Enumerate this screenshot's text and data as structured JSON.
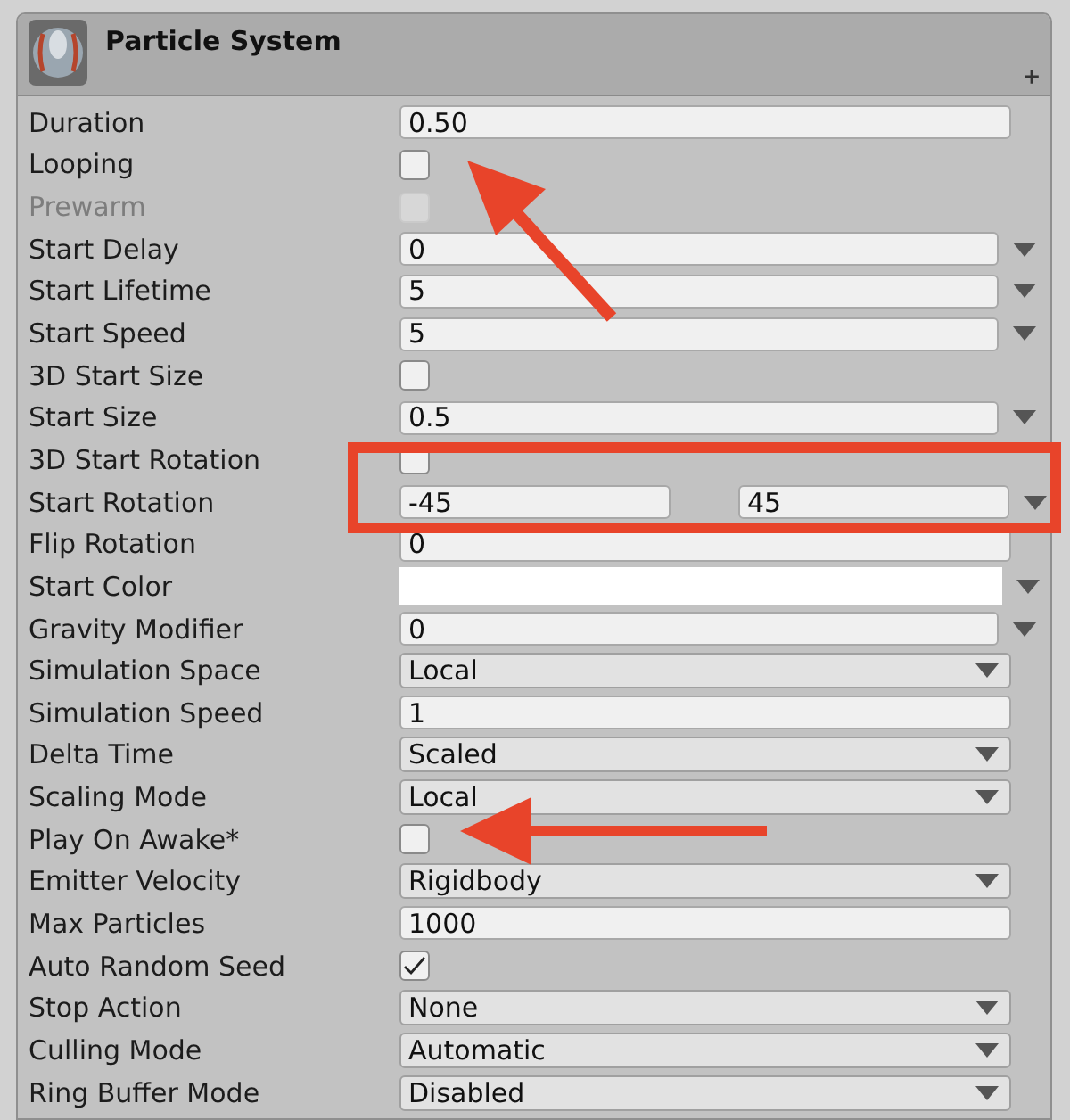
{
  "component": {
    "title": "Particle System",
    "add_symbol": "+"
  },
  "properties": [
    {
      "label": "Duration",
      "kind": "number",
      "value": "0.50",
      "disabled": false
    },
    {
      "label": "Looping",
      "kind": "checkbox",
      "checked": false,
      "disabled": false
    },
    {
      "label": "Prewarm",
      "kind": "checkbox",
      "checked": false,
      "disabled": true
    },
    {
      "label": "Start Delay",
      "kind": "curve",
      "value": "0",
      "disabled": false
    },
    {
      "label": "Start Lifetime",
      "kind": "curve",
      "value": "5",
      "disabled": false
    },
    {
      "label": "Start Speed",
      "kind": "curve",
      "value": "5",
      "disabled": false
    },
    {
      "label": "3D Start Size",
      "kind": "checkbox",
      "checked": false,
      "disabled": false
    },
    {
      "label": "Start Size",
      "kind": "curve",
      "value": "0.5",
      "disabled": false
    },
    {
      "label": "3D Start Rotation",
      "kind": "checkbox",
      "checked": false,
      "disabled": false
    },
    {
      "label": "Start Rotation",
      "kind": "range",
      "min": "-45",
      "max": "45",
      "disabled": false
    },
    {
      "label": "Flip Rotation",
      "kind": "number",
      "value": "0",
      "disabled": false
    },
    {
      "label": "Start Color",
      "kind": "color",
      "color": "#ffffff",
      "disabled": false
    },
    {
      "label": "Gravity Modifier",
      "kind": "curve",
      "value": "0",
      "disabled": false
    },
    {
      "label": "Simulation Space",
      "kind": "dropdown",
      "value": "Local",
      "disabled": false
    },
    {
      "label": "Simulation Speed",
      "kind": "number",
      "value": "1",
      "disabled": false
    },
    {
      "label": "Delta Time",
      "kind": "dropdown",
      "value": "Scaled",
      "disabled": false
    },
    {
      "label": "Scaling Mode",
      "kind": "dropdown",
      "value": "Local",
      "disabled": false
    },
    {
      "label": "Play On Awake*",
      "kind": "checkbox",
      "checked": false,
      "disabled": false
    },
    {
      "label": "Emitter Velocity",
      "kind": "dropdown",
      "value": "Rigidbody",
      "disabled": false
    },
    {
      "label": "Max Particles",
      "kind": "number",
      "value": "1000",
      "disabled": false
    },
    {
      "label": "Auto Random Seed",
      "kind": "checkbox",
      "checked": true,
      "disabled": false
    },
    {
      "label": "Stop Action",
      "kind": "dropdown",
      "value": "None",
      "disabled": false
    },
    {
      "label": "Culling Mode",
      "kind": "dropdown",
      "value": "Automatic",
      "disabled": false
    },
    {
      "label": "Ring Buffer Mode",
      "kind": "dropdown",
      "value": "Disabled",
      "disabled": false
    }
  ]
}
